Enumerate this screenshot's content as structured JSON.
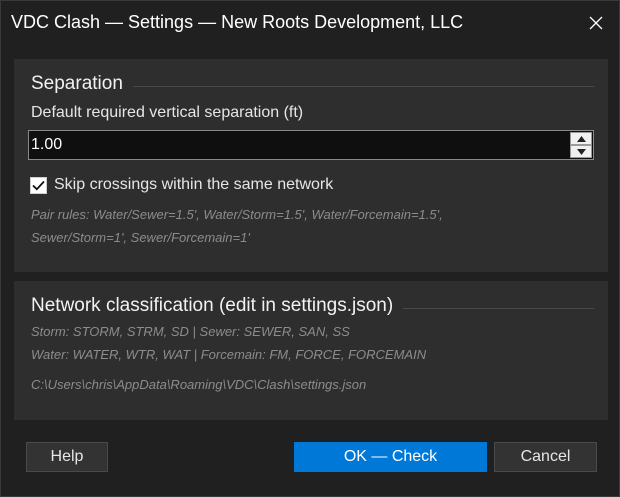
{
  "window": {
    "title": "VDC Clash — Settings — New Roots Development, LLC"
  },
  "separation": {
    "heading": "Separation",
    "field_label": "Default required vertical separation (ft)",
    "value": "1.00",
    "skip_label": "Skip crossings within the same network",
    "skip_checked": true,
    "pair_rules_line1": "Pair rules: Water/Sewer=1.5', Water/Storm=1.5', Water/Forcemain=1.5',",
    "pair_rules_line2": "Sewer/Storm=1', Sewer/Forcemain=1'"
  },
  "network": {
    "heading": "Network classification (edit in settings.json)",
    "line1": "Storm: STORM, STRM, SD  |  Sewer: SEWER, SAN, SS",
    "line2": "Water: WATER, WTR, WAT  |  Forcemain: FM, FORCE, FORCEMAIN",
    "path": "C:\\Users\\chris\\AppData\\Roaming\\VDC\\Clash\\settings.json"
  },
  "footer": {
    "help_label": "Help",
    "ok_label": "OK — Check",
    "cancel_label": "Cancel"
  },
  "colors": {
    "background": "#202020",
    "panel": "#2e2e2e",
    "accent": "#0078d7"
  }
}
